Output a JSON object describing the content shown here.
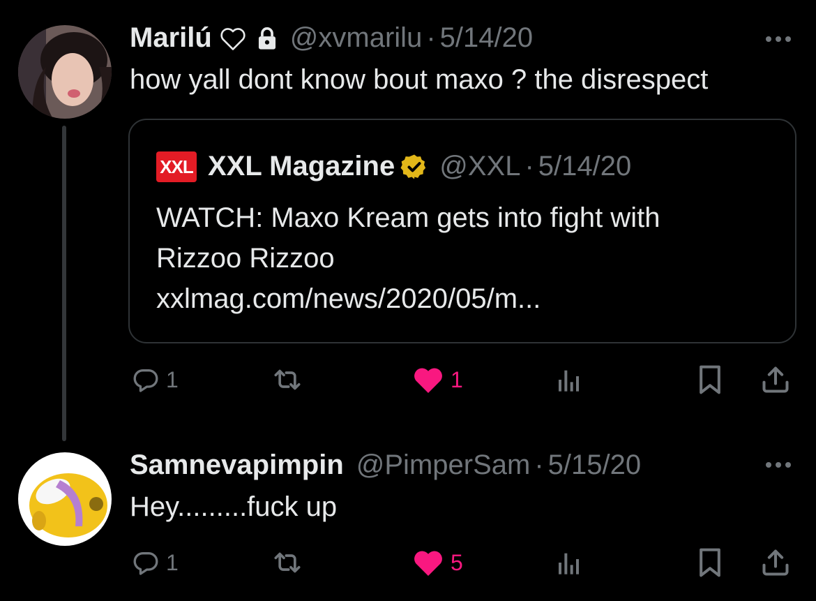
{
  "tweets": [
    {
      "name": "Marilú",
      "handle": "@xvmarilu",
      "date": "5/14/20",
      "text": "how yall dont know bout maxo ? the disrespect",
      "quote": {
        "logo_text": "XXL",
        "name": "XXL Magazine",
        "handle": "@XXL",
        "date": "5/14/20",
        "line1": "WATCH: Maxo Kream gets into fight with",
        "line2": "Rizzoo Rizzoo",
        "link": "xxlmag.com/news/2020/05/m..."
      },
      "replies": "1",
      "likes": "1"
    },
    {
      "name": "Samnevapimpin",
      "handle": "@PimperSam",
      "date": "5/15/20",
      "text": "Hey.........fuck up",
      "replies": "1",
      "likes": "5"
    }
  ],
  "separator": "·",
  "colors": {
    "like": "#f91880",
    "muted": "#71767b",
    "verified_gold": "#e2b719",
    "xxl_red": "#e31c25"
  },
  "icons": [
    "heart-outline-icon",
    "lock-icon",
    "verified-badge-icon",
    "more-icon",
    "reply-icon",
    "retweet-icon",
    "like-icon",
    "views-icon",
    "bookmark-icon",
    "share-icon"
  ]
}
